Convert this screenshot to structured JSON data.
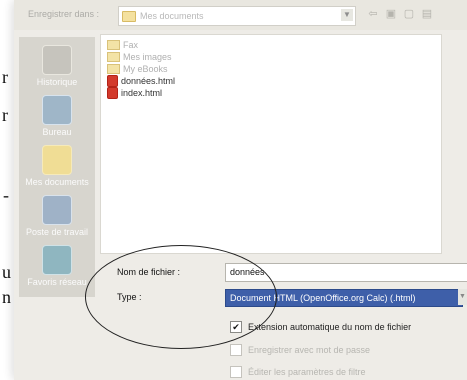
{
  "left_edge_text": [
    "r",
    "r",
    "-",
    "u",
    "n"
  ],
  "dialog": {
    "lookin_label": "Enregistrer dans :",
    "lookin_value": "Mes documents",
    "places": [
      "Historique",
      "Bureau",
      "Mes documents",
      "Poste de travail",
      "Favoris réseau"
    ],
    "files": [
      {
        "name": "Fax",
        "kind": "folder"
      },
      {
        "name": "Mes images",
        "kind": "folder"
      },
      {
        "name": "My eBooks",
        "kind": "folder"
      },
      {
        "name": "données.html",
        "kind": "html"
      },
      {
        "name": "index.html",
        "kind": "html"
      }
    ],
    "filename_label": "Nom de fichier :",
    "filename_value": "données",
    "type_label": "Type :",
    "type_value": "Document HTML (OpenOffice.org Calc) (.html)",
    "options": [
      {
        "label": "Extension automatique du nom de fichier",
        "checked": true,
        "enabled": true
      },
      {
        "label": "Enregistrer avec mot de passe",
        "checked": false,
        "enabled": false
      },
      {
        "label": "Éditer les paramètres de filtre",
        "checked": false,
        "enabled": false
      }
    ]
  }
}
